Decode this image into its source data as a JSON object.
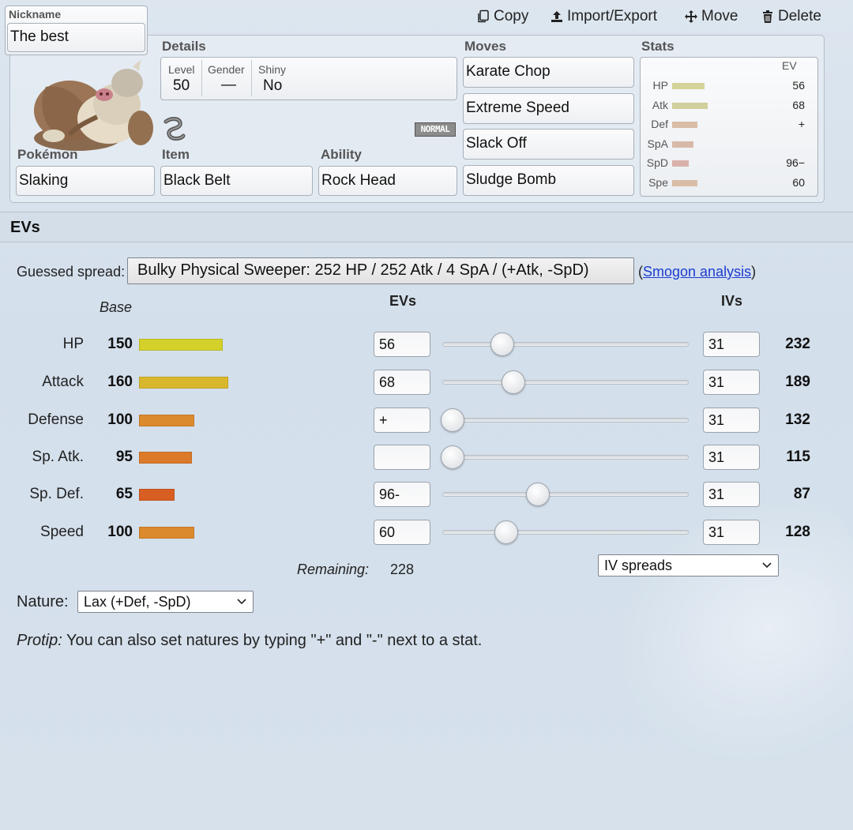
{
  "toolbar": {
    "copy": "Copy",
    "import_export": "Import/Export",
    "move": "Move",
    "delete": "Delete"
  },
  "set": {
    "nickname_label": "Nickname",
    "nickname": "The best",
    "details_label": "Details",
    "level_label": "Level",
    "level": "50",
    "gender_label": "Gender",
    "gender": "—",
    "shiny_label": "Shiny",
    "shiny": "No",
    "type_badge": "NORMAL",
    "pokemon_label": "Pokémon",
    "pokemon": "Slaking",
    "item_label": "Item",
    "item": "Black Belt",
    "ability_label": "Ability",
    "ability": "Rock Head",
    "moves_label": "Moves",
    "moves": [
      "Karate Chop",
      "Extreme Speed",
      "Slack Off",
      "Sludge Bomb"
    ],
    "stats_label": "Stats",
    "ev_header": "EV",
    "mini_stats": [
      {
        "label": "HP",
        "ev": "56",
        "fill": 0.27,
        "color": "#d3d39a"
      },
      {
        "label": "Atk",
        "ev": "68",
        "fill": 0.3,
        "color": "#d1cf9c"
      },
      {
        "label": "Def",
        "ev": "+",
        "fill": 0.21,
        "color": "#d9bda7"
      },
      {
        "label": "SpA",
        "ev": "",
        "fill": 0.18,
        "color": "#d8b9a8"
      },
      {
        "label": "SpD",
        "ev": "96−",
        "fill": 0.14,
        "color": "#d8b2aa"
      },
      {
        "label": "Spe",
        "ev": "60",
        "fill": 0.21,
        "color": "#d9bca6"
      }
    ]
  },
  "evs": {
    "title": "EVs",
    "guessed_label": "Guessed spread:",
    "guessed_button": "Bulky Physical Sweeper: 252 HP / 252 Atk / 4 SpA / (+Atk, -SpD)",
    "smogon_open": "(",
    "smogon_link": "Smogon analysis",
    "smogon_close": ")",
    "col_base": "Base",
    "col_evs": "EVs",
    "col_ivs": "IVs",
    "stats": [
      {
        "name": "HP",
        "base": "150",
        "base_fill": 0.59,
        "bar_color": "#d4d12a",
        "ev": "56",
        "ev_value": 56,
        "iv": "31",
        "total": "232"
      },
      {
        "name": "Attack",
        "base": "160",
        "base_fill": 0.63,
        "bar_color": "#d9b72c",
        "ev": "68",
        "ev_value": 68,
        "iv": "31",
        "total": "189"
      },
      {
        "name": "Defense",
        "base": "100",
        "base_fill": 0.39,
        "bar_color": "#dc8a2e",
        "ev": "+",
        "ev_value": 0,
        "iv": "31",
        "total": "132"
      },
      {
        "name": "Sp. Atk.",
        "base": "95",
        "base_fill": 0.37,
        "bar_color": "#dc7a2a",
        "ev": "",
        "ev_value": 0,
        "iv": "31",
        "total": "115"
      },
      {
        "name": "Sp. Def.",
        "base": "65",
        "base_fill": 0.25,
        "bar_color": "#d85e22",
        "ev": "96-",
        "ev_value": 96,
        "iv": "31",
        "total": "87"
      },
      {
        "name": "Speed",
        "base": "100",
        "base_fill": 0.39,
        "bar_color": "#dc8a2e",
        "ev": "60",
        "ev_value": 60,
        "iv": "31",
        "total": "128"
      }
    ],
    "remaining_label": "Remaining:",
    "remaining": "228",
    "iv_spreads": "IV spreads",
    "nature_label": "Nature:",
    "nature": "Lax (+Def, -SpD)",
    "protip_label": "Protip:",
    "protip_text": " You can also set natures by typing \"+\" and \"-\" next to a stat."
  }
}
